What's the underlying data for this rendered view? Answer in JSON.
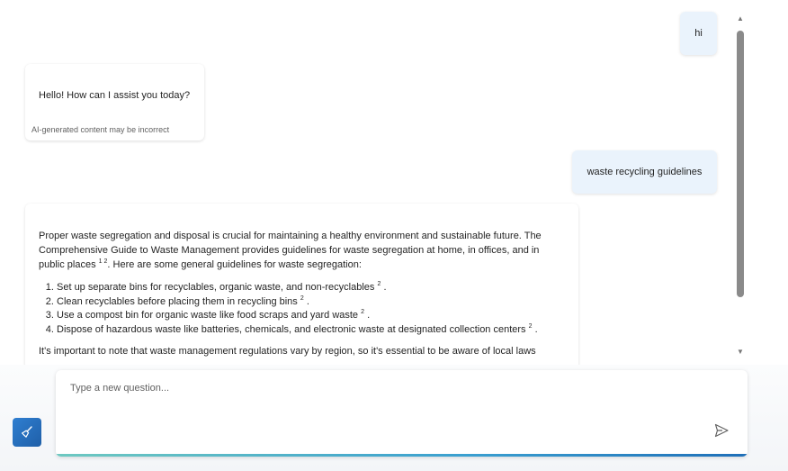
{
  "messages": {
    "user_1": "hi",
    "bot_1": "Hello! How can I assist you today?",
    "disclaimer": "AI-generated content may be incorrect",
    "user_2": "waste recycling guidelines",
    "answer": {
      "intro_1": "Proper waste segregation and disposal is crucial for maintaining a healthy environment and sustainable future. The Comprehensive Guide to Waste Management provides guidelines for waste segregation at home, in offices, and in public places",
      "intro_refs": "1 2",
      "intro_2": ". Here are some general guidelines for waste segregation:",
      "items": [
        {
          "text": "Set up separate bins for recyclables, organic waste, and non-recyclables",
          "ref": "2",
          "end": "."
        },
        {
          "text": "Clean recyclables before placing them in recycling bins",
          "ref": "2",
          "end": "."
        },
        {
          "text": "Use a compost bin for organic waste like food scraps and yard waste",
          "ref": "2",
          "end": "."
        },
        {
          "text": "Dispose of hazardous waste like batteries, chemicals, and electronic waste at designated collection centers",
          "ref": "2",
          "end": "."
        }
      ],
      "outro": "It's important to note that waste management regulations vary by region, so it's essential to be aware of local laws"
    }
  },
  "input": {
    "placeholder": "Type a new question..."
  },
  "icons": {
    "new_chat": "broom-icon",
    "send": "send-icon",
    "scroll_up": "scroll-up-arrow-icon",
    "scroll_down": "scroll-down-arrow-icon"
  },
  "colors": {
    "user_bubble": "#eaf3fc",
    "accent": "#1f6fb8",
    "accent_start": "#6ec9c1"
  }
}
